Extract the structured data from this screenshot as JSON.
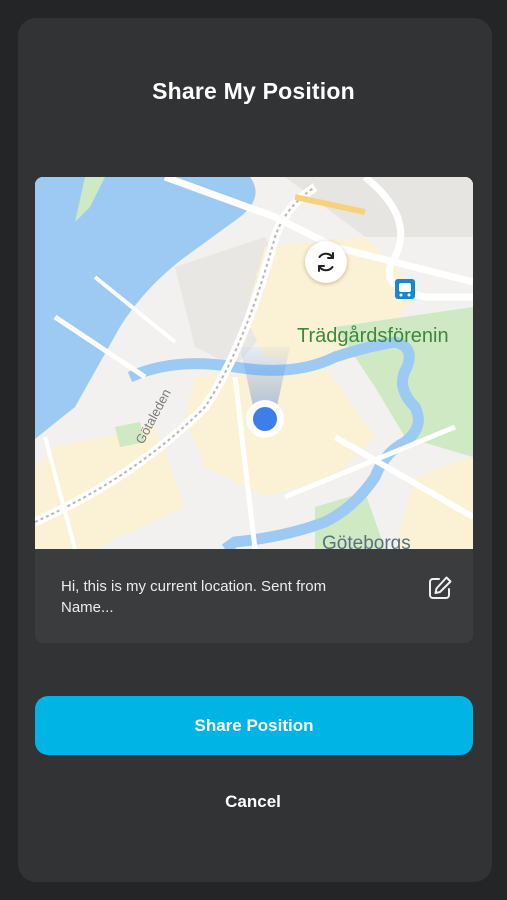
{
  "dialog": {
    "title": "Share My Position"
  },
  "map": {
    "labels": {
      "park": "Trädgårdsförenin",
      "road": "Götaleden",
      "area": "Göteborgs"
    },
    "refresh_icon": "refresh-icon",
    "transit_icon": "train-icon",
    "colors": {
      "water": "#9ccaf2",
      "land": "#f2f1ef",
      "park": "#cfe9c4",
      "urban": "#fbf1d4",
      "road": "#ffffff",
      "marker": "#3f7ee8"
    }
  },
  "message": {
    "text": "Hi, this is my current location. Sent from Name...",
    "edit_icon": "edit-icon"
  },
  "actions": {
    "share_label": "Share Position",
    "cancel_label": "Cancel"
  },
  "colors": {
    "background": "#242526",
    "sheet": "#323334",
    "accent": "#00b4e6"
  }
}
